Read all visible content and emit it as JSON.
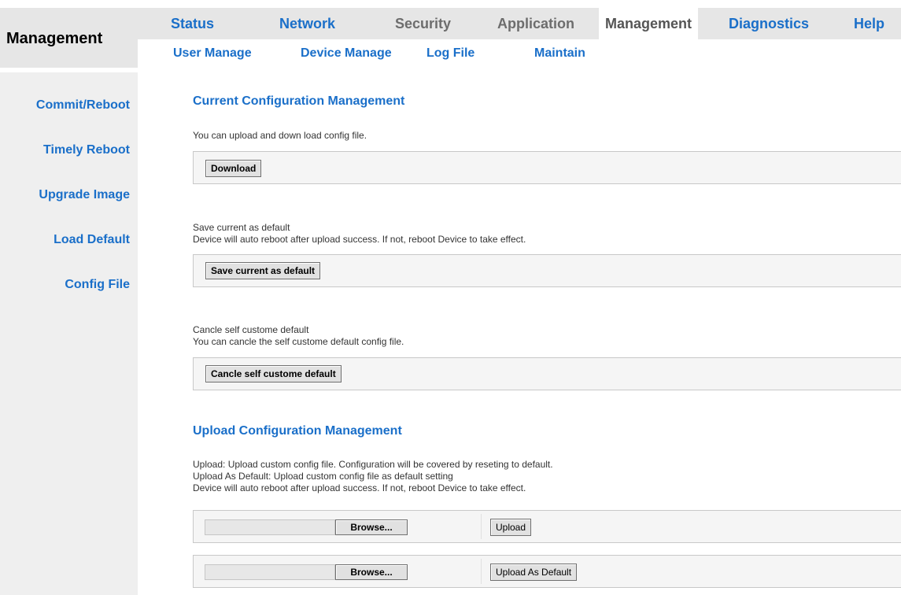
{
  "brand": {
    "title": "Management"
  },
  "nav": {
    "tabs": [
      {
        "label": "Status",
        "state": "link"
      },
      {
        "label": "Network",
        "state": "link"
      },
      {
        "label": "Security",
        "state": "muted"
      },
      {
        "label": "Application",
        "state": "muted"
      },
      {
        "label": "Management",
        "state": "active"
      },
      {
        "label": "Diagnostics",
        "state": "link"
      },
      {
        "label": "Help",
        "state": "link"
      }
    ],
    "subtabs": [
      "User Manage",
      "Device Manage",
      "Log File",
      "Maintain"
    ]
  },
  "sidebar": {
    "items": [
      "Commit/Reboot",
      "Timely Reboot",
      "Upgrade Image",
      "Load Default",
      "Config File"
    ]
  },
  "current": {
    "heading": "Current Configuration Management",
    "intro": "You can upload and down load config file.",
    "download_label": "Download",
    "save_title": "Save current as default",
    "save_note": "Device will auto reboot after upload success. If not, reboot Device to take effect.",
    "save_label": "Save current as default",
    "cancel_title": "Cancle self custome default",
    "cancel_note": "You can cancle the self custome default config file.",
    "cancel_label": "Cancle self custome default"
  },
  "upload": {
    "heading": "Upload Configuration Management",
    "line1": "Upload: Upload custom config file. Configuration will be covered by reseting to default.",
    "line2": "Upload As Default: Upload custom config file as default setting",
    "line3": "Device will auto reboot after upload success. If not, reboot Device to take effect.",
    "browse_label": "Browse...",
    "upload_label": "Upload",
    "upload_default_label": "Upload As Default"
  },
  "colors": {
    "accent": "#1a6fc9",
    "muted": "#6d6d6d",
    "panel": "#e6e6e6"
  }
}
